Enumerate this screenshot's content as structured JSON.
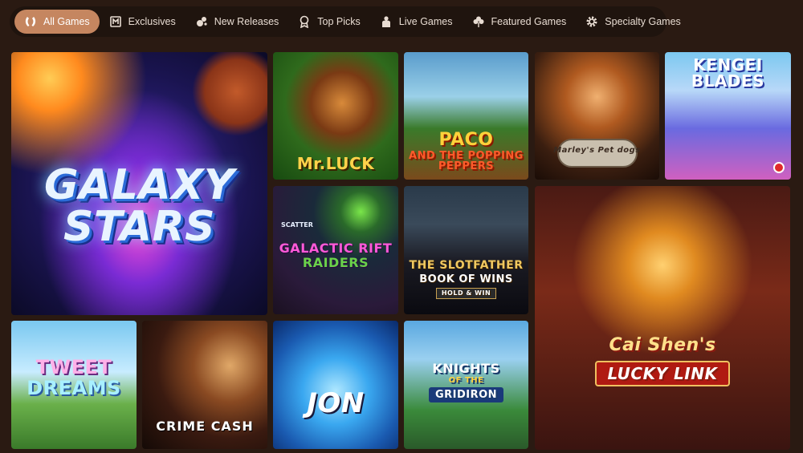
{
  "nav": {
    "items": [
      {
        "label": "All Games",
        "icon": "horseshoe-icon",
        "active": true
      },
      {
        "label": "Exclusives",
        "icon": "exclusive-icon",
        "active": false
      },
      {
        "label": "New Releases",
        "icon": "new-releases-icon",
        "active": false
      },
      {
        "label": "Top Picks",
        "icon": "award-icon",
        "active": false
      },
      {
        "label": "Live Games",
        "icon": "dealer-icon",
        "active": false
      },
      {
        "label": "Featured Games",
        "icon": "clover-icon",
        "active": false
      },
      {
        "label": "Specialty Games",
        "icon": "gear-icon",
        "active": false
      }
    ]
  },
  "games": {
    "galaxy": {
      "title1": "GALAXY",
      "title2": "STARS"
    },
    "mrluck": {
      "title": "Mr.LUCK"
    },
    "paco": {
      "title": "PACO",
      "sub": "AND THE POPPING PEPPERS"
    },
    "marley": {
      "title": "Marley's Pet dogs"
    },
    "kengei": {
      "title": "KENGEI BLADES"
    },
    "galactic": {
      "badge": "SCATTER",
      "title": "GALACTIC RIFT",
      "sub": "RAIDERS"
    },
    "slot": {
      "title": "THE SLOTFATHER",
      "sub": "BOOK OF WINS",
      "sub2": "HOLD & WIN"
    },
    "caishen": {
      "title": "Cai Shen's",
      "sub": "LUCKY LINK"
    },
    "tweet": {
      "title": "TWEET",
      "sub": "DREAMS"
    },
    "crime": {
      "title": "CRIME CASH"
    },
    "jon": {
      "title": "JON"
    },
    "knights": {
      "title": "KNIGHTS",
      "sub": "OF THE",
      "sub2": "GRIDIRON"
    }
  }
}
